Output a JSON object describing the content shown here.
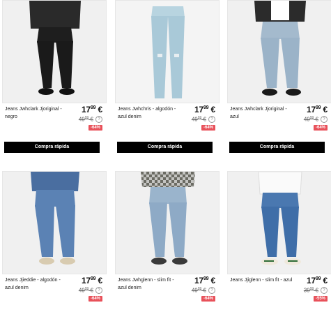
{
  "quick_buy_label": "Compra rápida",
  "products": [
    {
      "name": "Jeans Jwhclark Jjoriginal - negro",
      "price_int": "17",
      "price_dec": "99",
      "price_cur": "€",
      "old_int": "49",
      "old_dec": "99",
      "old_cur": "€",
      "discount": "-64%",
      "denim_color": "#1e1e1e",
      "info_icon": "?"
    },
    {
      "name": "Jeans Jwhchris - algodón - azul denim",
      "price_int": "17",
      "price_dec": "99",
      "price_cur": "€",
      "old_int": "49",
      "old_dec": "99",
      "old_cur": "€",
      "discount": "-64%",
      "denim_color": "#a9c9d8",
      "info_icon": "?"
    },
    {
      "name": "Jeans Jwhclark Jjoriginal - azul",
      "price_int": "17",
      "price_dec": "99",
      "price_cur": "€",
      "old_int": "49",
      "old_dec": "99",
      "old_cur": "€",
      "discount": "-64%",
      "denim_color": "#9bb3c8",
      "info_icon": "?"
    },
    {
      "name": "Jeans Jjieddie - algodón - azul denim",
      "price_int": "17",
      "price_dec": "99",
      "price_cur": "€",
      "old_int": "49",
      "old_dec": "99",
      "old_cur": "€",
      "discount": "-64%",
      "denim_color": "#5b82b4",
      "info_icon": "?"
    },
    {
      "name": "Jeans Jwhglenn - slim fit - azul denim",
      "price_int": "17",
      "price_dec": "99",
      "price_cur": "€",
      "old_int": "49",
      "old_dec": "99",
      "old_cur": "€",
      "discount": "-64%",
      "denim_color": "#8eaac6",
      "info_icon": "?"
    },
    {
      "name": "Jeans Jjiglenn - slim fit - azul",
      "price_int": "17",
      "price_dec": "99",
      "price_cur": "€",
      "old_int": "39",
      "old_dec": "99",
      "old_cur": "€",
      "discount": "-55%",
      "denim_color": "#3f6ea8",
      "info_icon": "?"
    }
  ]
}
